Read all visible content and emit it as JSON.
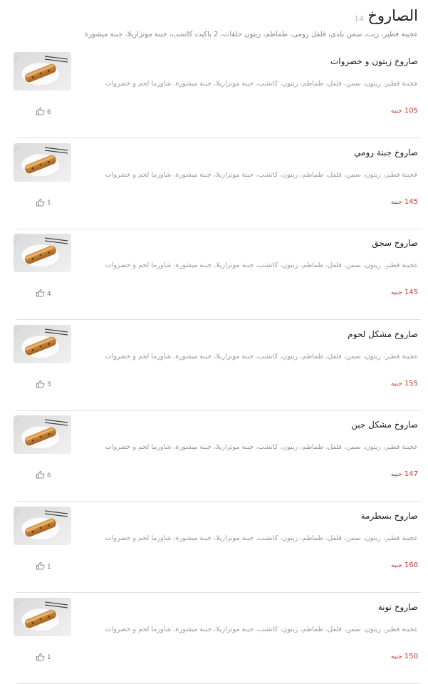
{
  "section": {
    "title": "الصاروخ",
    "count": "14",
    "description": "عجينة فطير، زيت، سمن بلدى، فلفل رومى، طماطم، زيتون حلقات، 2 باكيت كاتشب، جبنة موتزاريلا، جبنة ميشورة"
  },
  "currency": "جنيه",
  "items": [
    {
      "name": "صاروخ زيتون و خضروات",
      "description": "عجينة فطير، زيتون، سمن، فلفل، طماطم، زيتون، كاتشب، جبنة موتزاريلا، جبنة ميشورة، شاورما لحم و خضروات",
      "price": "105",
      "likes": "6"
    },
    {
      "name": "صاروخ جبنة رومي",
      "description": "عجينة فطير، زيتون، سمن، فلفل، طماطم، زيتون، كاتشب، جبنة موتزاريلا، جبنة ميشورة، شاورما لحم و خضروات",
      "price": "145",
      "likes": "1"
    },
    {
      "name": "صاروخ سجق",
      "description": "عجينة فطير، زيتون، سمن، فلفل، طماطم، زيتون، كاتشب، جبنة موتزاريلا، جبنة ميشورة، شاورما لحم و خضروات",
      "price": "145",
      "likes": "4"
    },
    {
      "name": "صاروخ مشكل لحوم",
      "description": "عجينة فطير، زيتون، سمن، فلفل، طماطم، زيتون، كاتشب، جبنة موتزاريلا، جبنة ميشورة، شاورما لحم و خضروات",
      "price": "155",
      "likes": "3"
    },
    {
      "name": "صاروخ مشكل جبن",
      "description": "عجينة فطير، زيتون، سمن، فلفل، طماطم، زيتون، كاتشب، جبنة موتزاريلا، جبنة ميشورة، شاورما لحم و خضروات",
      "price": "147",
      "likes": "6"
    },
    {
      "name": "صاروخ بسطرمة",
      "description": "عجينة فطير، زيتون، سمن، فلفل، طماطم، زيتون، كاتشب، جبنة موتزاريلا، جبنة ميشورة، شاورما لحم و خضروات",
      "price": "160",
      "likes": "1"
    },
    {
      "name": "صاروخ تونة",
      "description": "عجينة فطير، زيتون، سمن، فلفل، طماطم، زيتون، كاتشب، جبنة موتزاريلا، جبنة ميشورة، شاورما لحم و خضروات",
      "price": "150",
      "likes": "1"
    }
  ],
  "colors": {
    "price": "#c0392b",
    "divider": "#e2e2e2",
    "description": "#999999"
  },
  "icons": {
    "like": "thumbs-up-icon",
    "thumbnail": "food-photo"
  }
}
